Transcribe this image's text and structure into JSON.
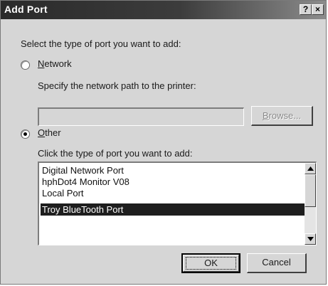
{
  "window": {
    "title": "Add Port",
    "help_glyph": "?",
    "close_glyph": "×"
  },
  "prompt": "Select the type of port you want to add:",
  "network": {
    "mnemonic": "N",
    "label_rest": "etwork",
    "selected": false,
    "path_label": "Specify the network path to the printer:",
    "path_value": "",
    "browse_mnemonic": "B",
    "browse_rest": "rowse..."
  },
  "other": {
    "mnemonic": "O",
    "label_rest": "ther",
    "selected": true,
    "list_label": "Click the type of port you want to add:",
    "items": [
      "Digital Network Port",
      "hphDot4 Monitor V08",
      "Local Port",
      "Troy BlueTooth Port"
    ],
    "selected_index": 3
  },
  "buttons": {
    "ok": "OK",
    "cancel": "Cancel"
  },
  "icons": {
    "scroll_up": "up-arrow-icon",
    "scroll_down": "down-arrow-icon"
  }
}
